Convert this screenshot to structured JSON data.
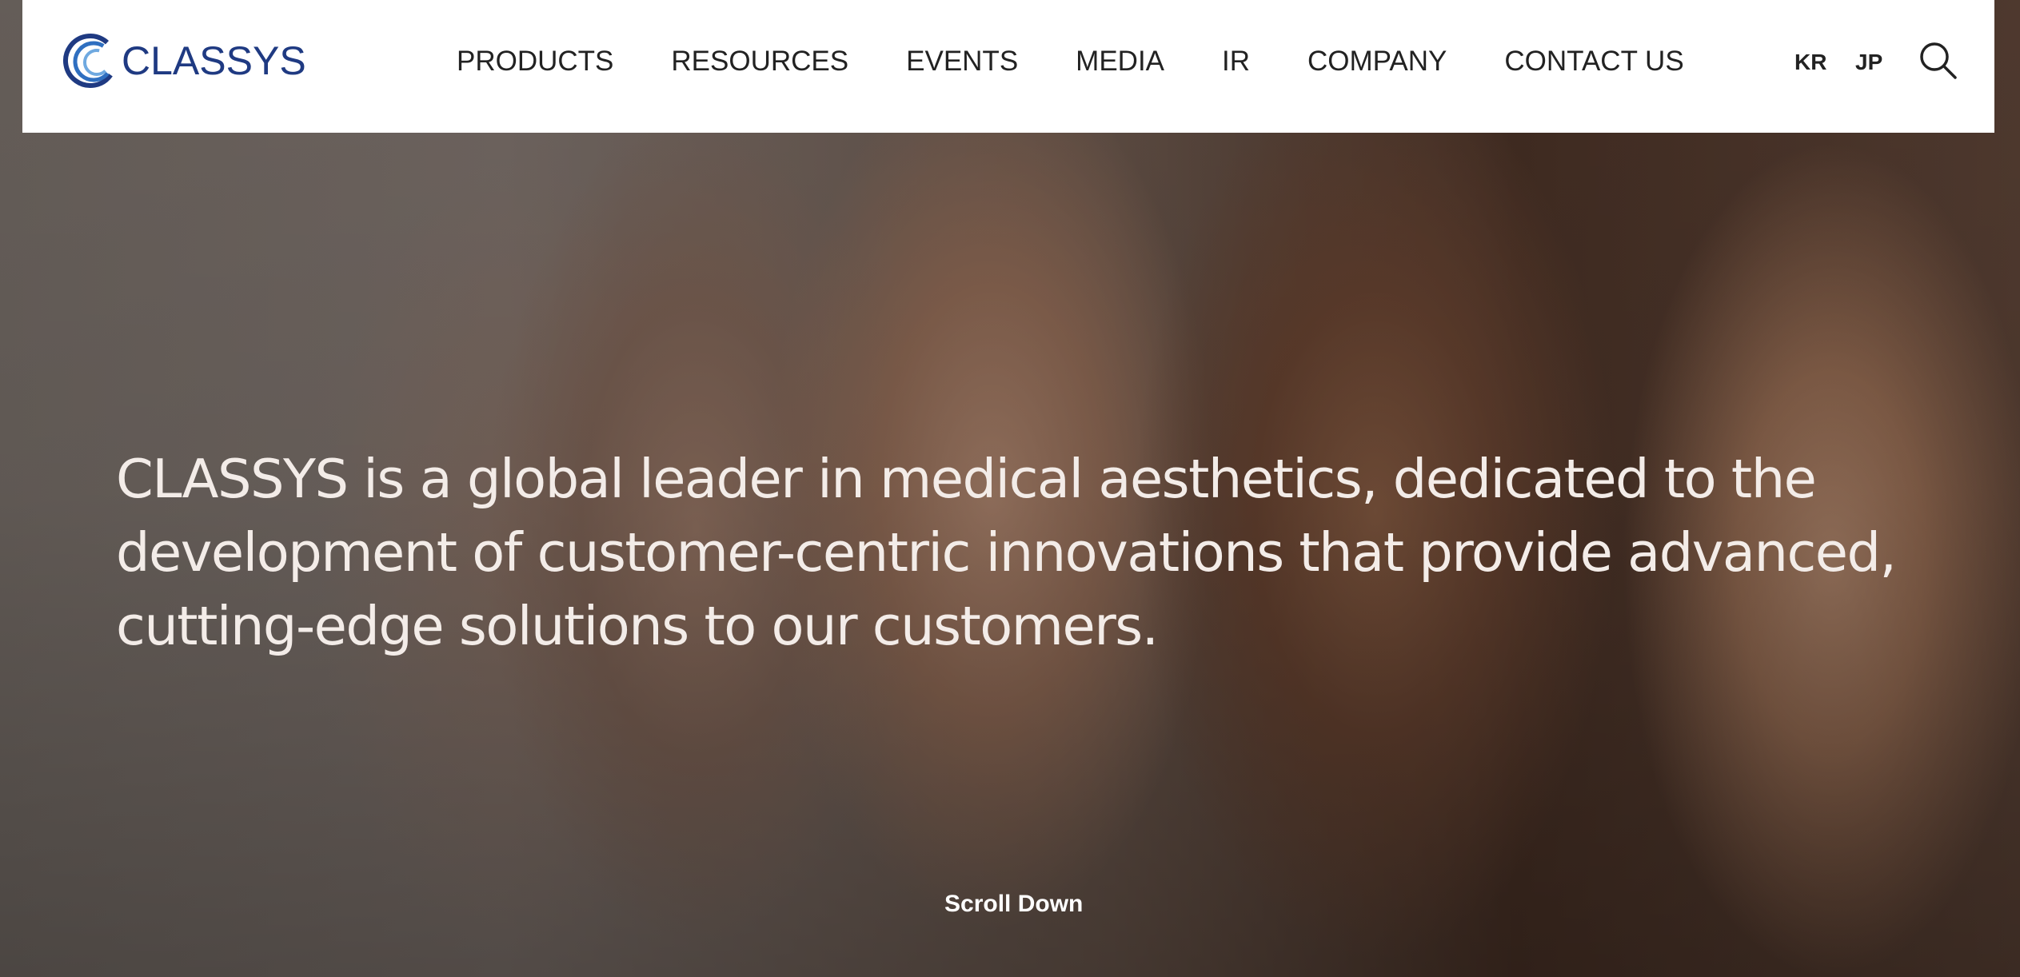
{
  "header": {
    "logo_text": "CLASSYS",
    "nav": [
      {
        "label": "PRODUCTS"
      },
      {
        "label": "RESOURCES"
      },
      {
        "label": "EVENTS"
      },
      {
        "label": "MEDIA"
      },
      {
        "label": "IR"
      },
      {
        "label": "COMPANY"
      },
      {
        "label": "CONTACT US"
      }
    ],
    "languages": [
      "KR",
      "JP"
    ],
    "search_icon": "search-icon",
    "brand_color": "#1f3a82"
  },
  "hero": {
    "headline": "CLASSYS is a global leader in medical aesthetics, dedicated to the development of customer-centric innovations that provide advanced, cutting-edge solutions to our customers.",
    "scroll_label": "Scroll Down"
  }
}
